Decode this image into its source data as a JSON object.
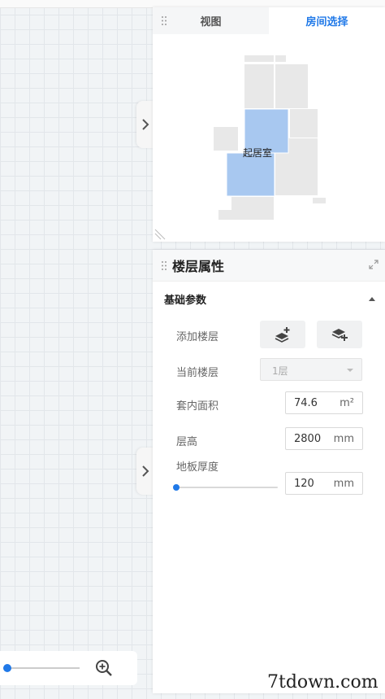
{
  "tabs": {
    "view": "视图",
    "room_select": "房间选择"
  },
  "floorplan": {
    "room_label": "起居室",
    "selected_color": "#a8c8f0",
    "room_color": "#e8e8e8"
  },
  "panel": {
    "title": "楼层属性",
    "section_title": "基础参数",
    "add_floor": {
      "label": "添加楼层"
    },
    "current_floor": {
      "label": "当前楼层",
      "value": "1层"
    },
    "area": {
      "label": "套内面积",
      "value": "74.6",
      "unit": "m²"
    },
    "height": {
      "label": "层高",
      "value": "2800",
      "unit": "mm"
    },
    "floor_thickness": {
      "label": "地板厚度",
      "value": "120",
      "unit": "mm"
    }
  },
  "watermark": "7tdown.com",
  "colors": {
    "accent": "#2079e8"
  }
}
